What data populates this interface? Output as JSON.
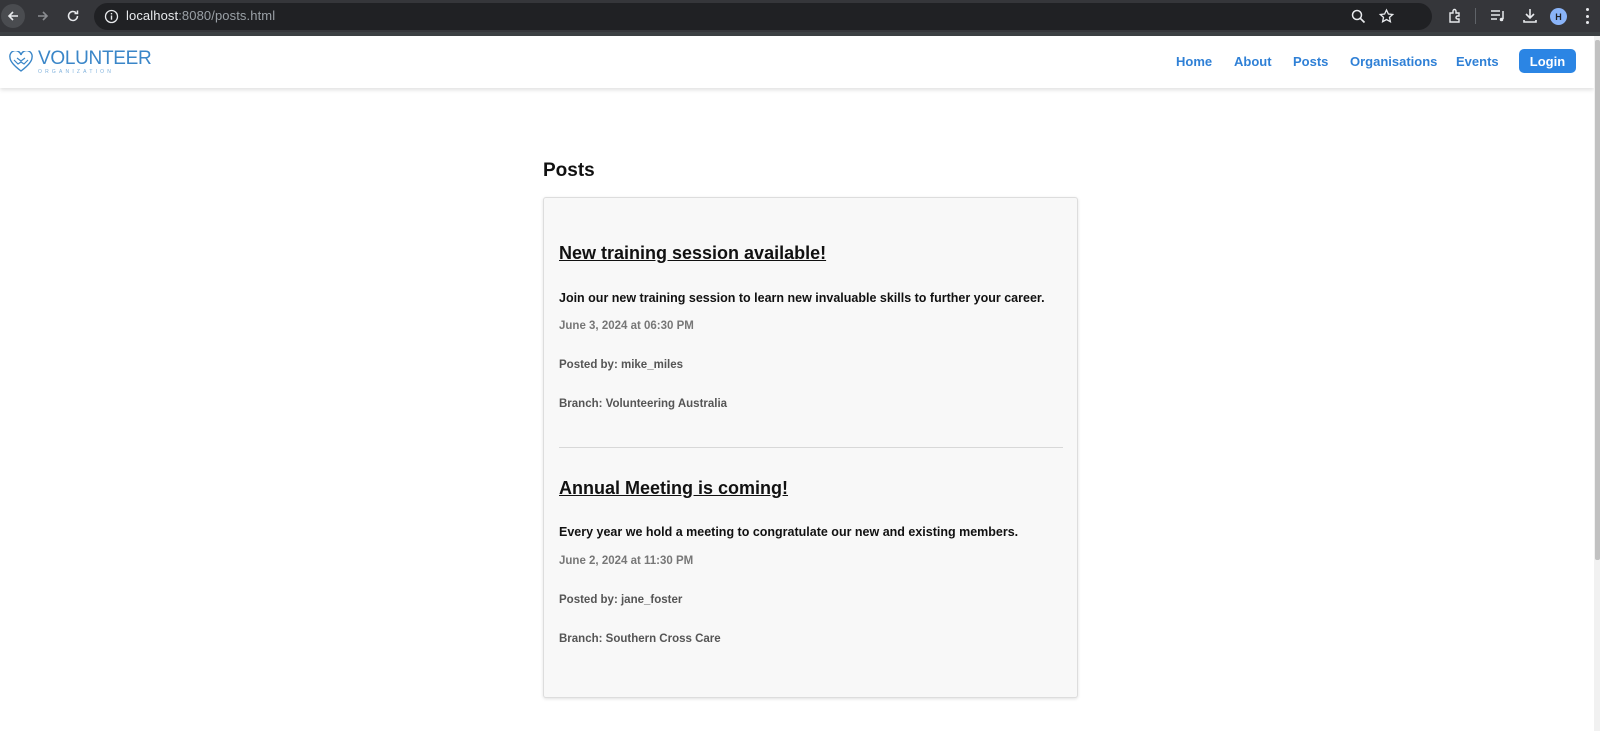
{
  "browser": {
    "url_host": "localhost",
    "url_rest": ":8080/posts.html",
    "avatar_letter": "H",
    "icons": [
      "back-arrow-icon",
      "forward-arrow-icon",
      "reload-icon",
      "site-info-icon",
      "zoom-icon",
      "bookmark-star-icon",
      "extensions-icon",
      "media-queue-icon",
      "download-icon",
      "profile-avatar",
      "menu-kebab-icon"
    ]
  },
  "site": {
    "logo_name": "VOLUNTEER",
    "logo_sub": "ORGANIZATION",
    "nav": {
      "home": "Home",
      "about": "About",
      "posts": "Posts",
      "organisations": "Organisations",
      "events": "Events"
    },
    "login_label": "Login",
    "accent_color": "#2b85e4"
  },
  "main": {
    "title": "Posts",
    "posts": [
      {
        "title": "New training session available!",
        "body": "Join our new training session to learn new invaluable skills to further your career.",
        "date": "June 3, 2024 at 06:30 PM",
        "posted_by": "Posted by: mike_miles",
        "branch": "Branch: Volunteering Australia"
      },
      {
        "title": "Annual Meeting is coming!",
        "body": "Every year we hold a meeting to congratulate our new and existing members.",
        "date": "June 2, 2024 at 11:30 PM",
        "posted_by": "Posted by: jane_foster",
        "branch": "Branch: Southern Cross Care"
      }
    ]
  }
}
